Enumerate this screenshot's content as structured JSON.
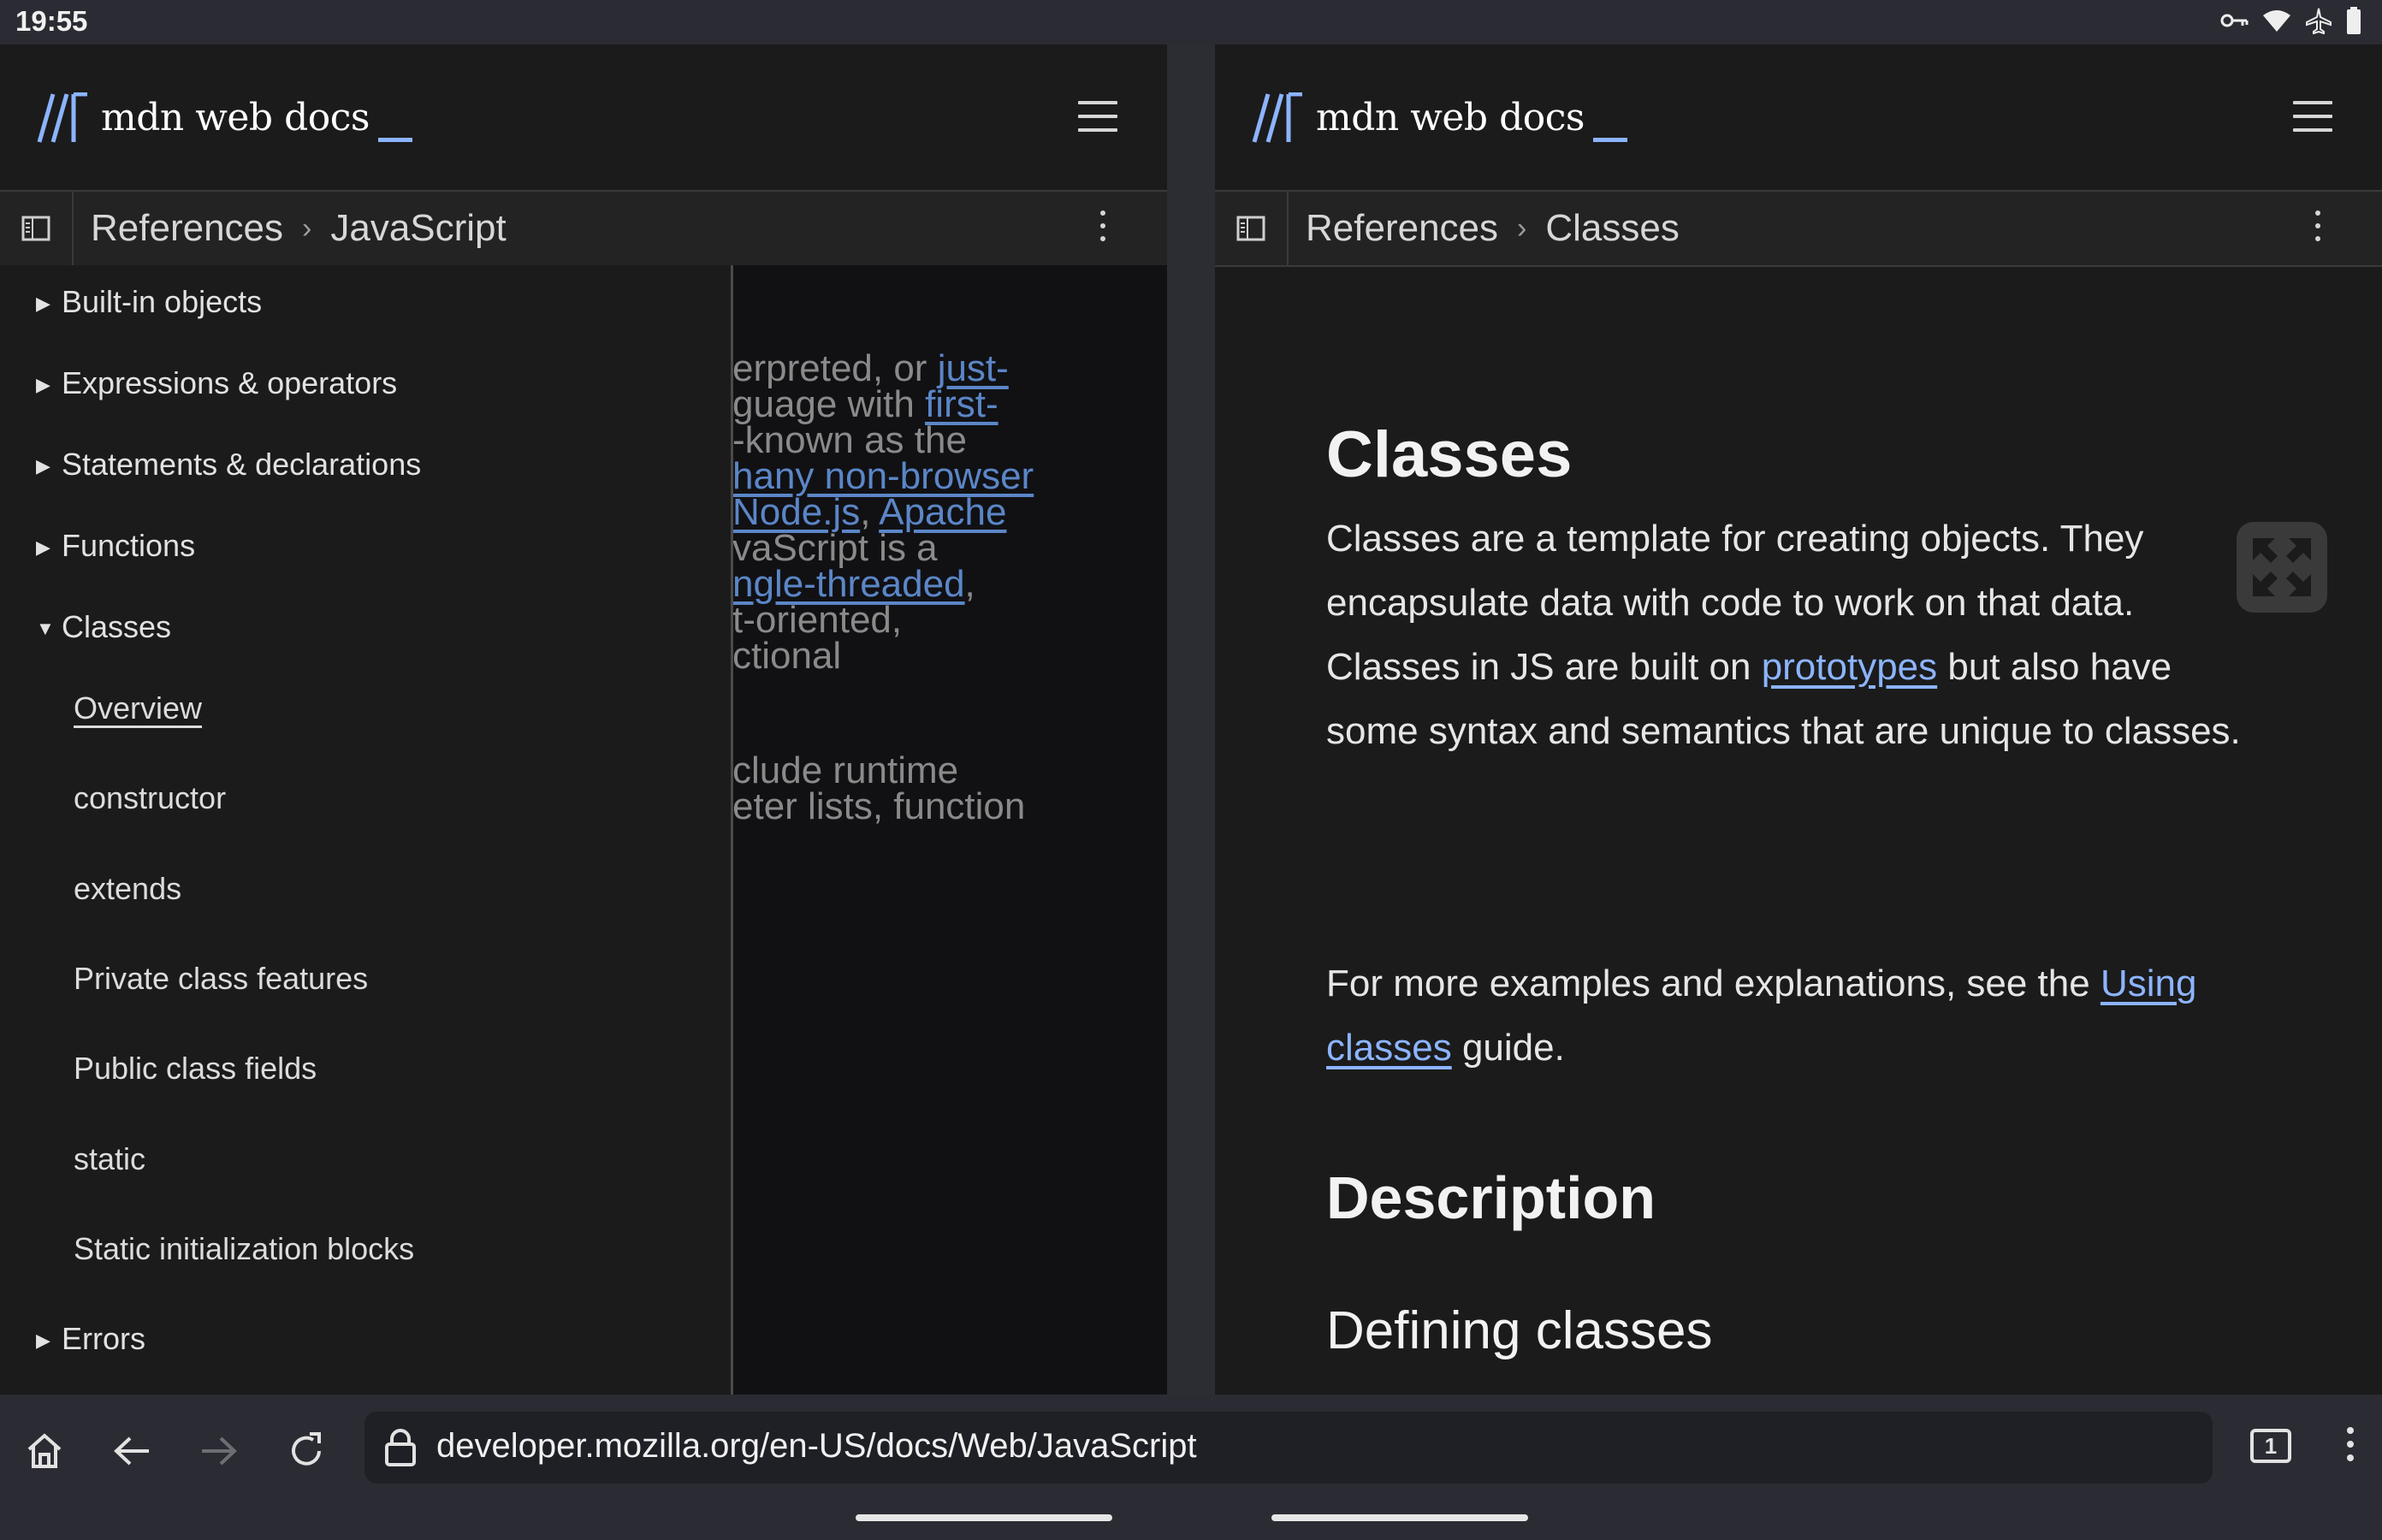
{
  "status_bar": {
    "time": "19:55",
    "icons": [
      "vpn-key-icon",
      "wifi-icon",
      "airplane-mode-icon",
      "battery-icon"
    ]
  },
  "left_pane": {
    "logo_text": "mdn web docs",
    "breadcrumb": [
      "References",
      "JavaScript"
    ],
    "sidebar": {
      "items": [
        {
          "label": "Built-in objects",
          "expanded": false
        },
        {
          "label": "Expressions & operators",
          "expanded": false
        },
        {
          "label": "Statements & declarations",
          "expanded": false
        },
        {
          "label": "Functions",
          "expanded": false
        },
        {
          "label": "Classes",
          "expanded": true
        },
        {
          "label": "Errors",
          "expanded": false
        }
      ],
      "subitems": [
        "Overview",
        "constructor",
        "extends",
        "Private class features",
        "Public class fields",
        "static",
        "Static initialization blocks"
      ],
      "active_subitem": "Overview"
    },
    "behind_text": {
      "l1a": "erpreted, or ",
      "l1b": "just-",
      "l2a": "guage with ",
      "l2b": "first-",
      "l3": "-known as the",
      "l4": "hany non-browser",
      "l5a": "Node.js",
      "l5b": ", ",
      "l5c": "Apache",
      "l6": "vaScript is a",
      "l7a": "ngle-threaded",
      "l7b": ",",
      "l8": "t-oriented,",
      "l9": "ctional",
      "l10": "clude runtime",
      "l11": "eter lists, function"
    }
  },
  "right_pane": {
    "logo_text": "mdn web docs",
    "breadcrumb": [
      "References",
      "Classes"
    ],
    "title": "Classes",
    "para1": {
      "t1": "Classes are a template for creating objects. They encapsulate data with code to work on that data. Classes in JS are built on ",
      "link": "prototypes",
      "t2": " but also have some syntax and semantics that are unique to classes."
    },
    "para2": {
      "t1": "For more examples and explanations, see the ",
      "link": "Using classes",
      "t2": " guide."
    },
    "h2": "Description",
    "h3": "Defining classes"
  },
  "browser": {
    "url": "developer.mozilla.org/en-US/docs/Web/JavaScript",
    "tab_count": "1"
  }
}
